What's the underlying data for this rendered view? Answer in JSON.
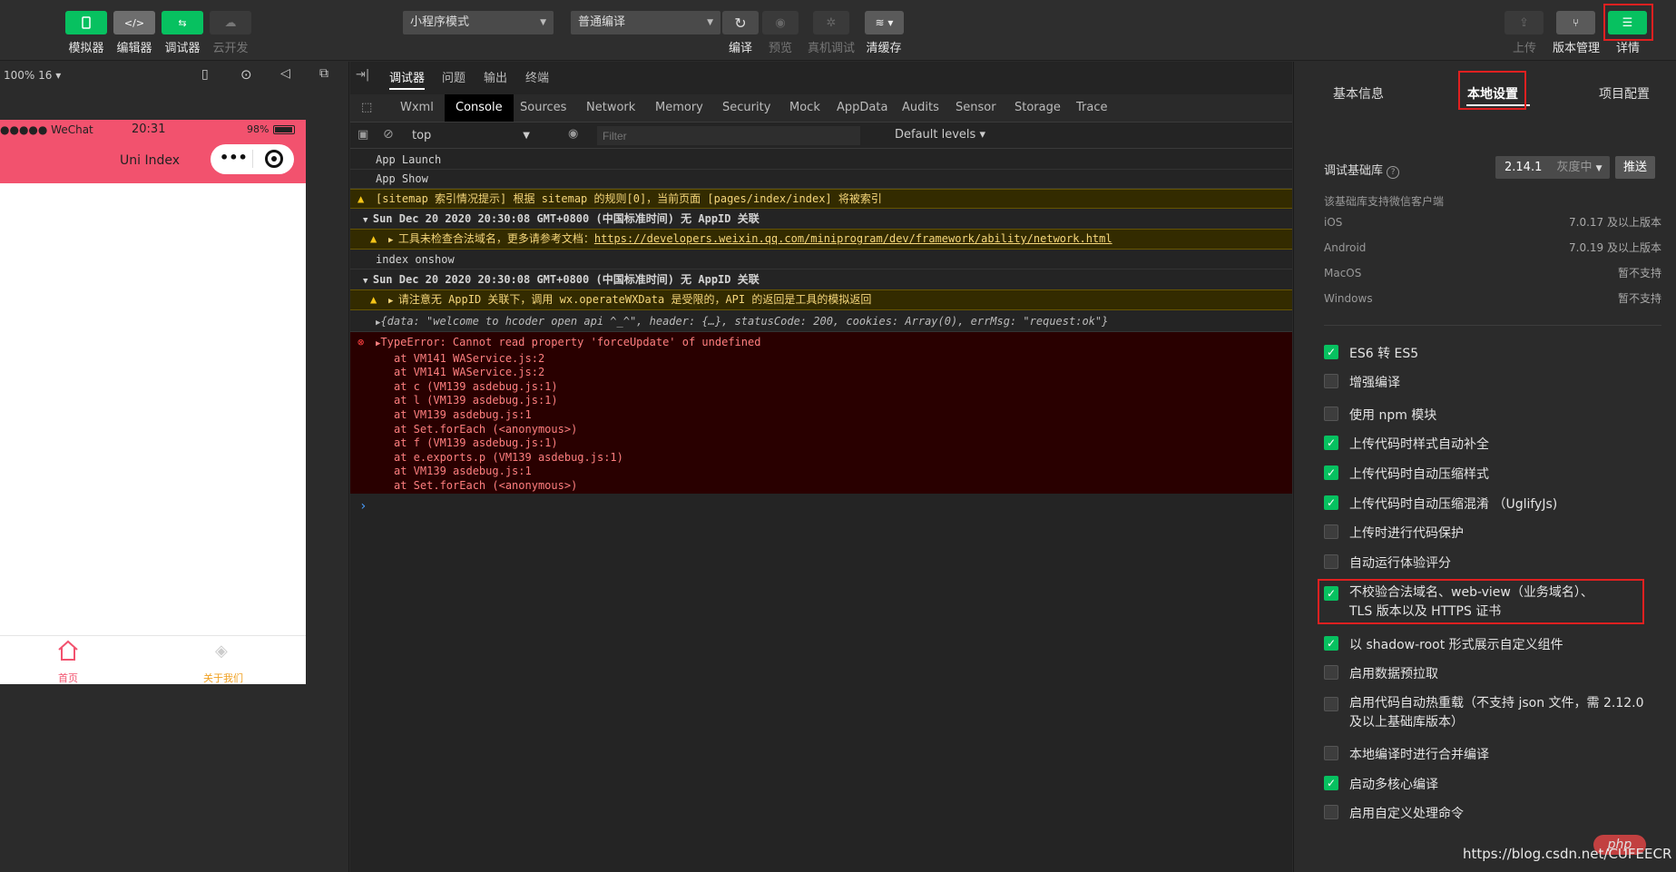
{
  "toolbar": {
    "left_buttons": [
      {
        "label": "模拟器",
        "icon": "phone-icon",
        "color": "#07c160"
      },
      {
        "label": "编辑器",
        "icon": "code-icon",
        "color": "#6e6e6e"
      },
      {
        "label": "调试器",
        "icon": "debug-icon",
        "color": "#07c160"
      },
      {
        "label": "云开发",
        "icon": "cloud-icon",
        "color": "#3a3a3a"
      }
    ],
    "mode_select": "小程序模式",
    "compile_select": "普通编译",
    "mid_buttons": [
      {
        "label": "编译",
        "icon": "refresh-icon"
      },
      {
        "label": "预览",
        "icon": "eye-icon"
      },
      {
        "label": "真机调试",
        "icon": "bug-icon"
      },
      {
        "label": "清缓存",
        "icon": "layers-icon"
      }
    ],
    "right_buttons": [
      {
        "label": "上传",
        "icon": "upload-icon"
      },
      {
        "label": "版本管理",
        "icon": "branch-icon"
      },
      {
        "label": "详情",
        "icon": "menu-icon"
      }
    ]
  },
  "simulator": {
    "zoom": "100% 16",
    "status_carrier": "●●●●● WeChat",
    "status_time": "20:31",
    "status_battery": "98%",
    "page_title": "Uni Index",
    "capsule_dots": "•••",
    "tabs": [
      {
        "label": "首页",
        "color": "#f2526e"
      },
      {
        "label": "关于我们",
        "color": "#f0a020"
      }
    ]
  },
  "debugger": {
    "top_tabs": [
      "调试器",
      "问题",
      "输出",
      "终端"
    ],
    "panel_tabs": [
      "Wxml",
      "Console",
      "Sources",
      "Network",
      "Memory",
      "Security",
      "Mock",
      "AppData",
      "Audits",
      "Sensor",
      "Storage",
      "Trace"
    ],
    "active_panel": "Console",
    "context": "top",
    "filter_placeholder": "Filter",
    "levels": "Default levels",
    "logs": {
      "l1": "App Launch",
      "l2": "App Show",
      "l3": "[sitemap 索引情况提示] 根据 sitemap 的规则[0]，当前页面 [pages/index/index] 将被索引",
      "l4": "Sun Dec 20 2020 20:30:08 GMT+0800 (中国标准时间) 无 AppID 关联",
      "l5_text": "工具未检查合法域名，更多请参考文档：",
      "l5_link": "https://developers.weixin.qq.com/miniprogram/dev/framework/ability/network.html",
      "l6": "index onshow",
      "l7": "Sun Dec 20 2020 20:30:08 GMT+0800 (中国标准时间) 无 AppID 关联",
      "l8": "请注意无 AppID 关联下，调用 wx.operateWXData 是受限的，API 的返回是工具的模拟返回",
      "l9": "{data: \"welcome to hcoder open api ^_^\", header: {…}, statusCode: 200, cookies: Array(0), errMsg: \"request:ok\"}",
      "err_title": "TypeError: Cannot read property 'forceUpdate' of undefined",
      "stack": [
        "at VM141 WAService.js:2",
        "at VM141 WAService.js:2",
        "at c (VM139 asdebug.js:1)",
        "at l (VM139 asdebug.js:1)",
        "at VM139 asdebug.js:1",
        "at Set.forEach (<anonymous>)",
        "at f (VM139 asdebug.js:1)",
        "at e.exports.p (VM139 asdebug.js:1)",
        "at VM139 asdebug.js:1",
        "at Set.forEach (<anonymous>)"
      ],
      "prompt": "›"
    }
  },
  "settings": {
    "tabs": [
      "基本信息",
      "本地设置",
      "项目配置"
    ],
    "active_tab": "本地设置",
    "lib_label": "调试基础库",
    "lib_version": "2.14.1",
    "lib_channel": "灰度中",
    "push_label": "推送",
    "support_title": "该基础库支持微信客户端",
    "support": [
      {
        "os": "iOS",
        "ver": "7.0.17 及以上版本"
      },
      {
        "os": "Android",
        "ver": "7.0.19 及以上版本"
      },
      {
        "os": "MacOS",
        "ver": "暂不支持"
      },
      {
        "os": "Windows",
        "ver": "暂不支持"
      }
    ],
    "options": [
      {
        "label": "ES6 转 ES5",
        "checked": true
      },
      {
        "label": "增强编译",
        "checked": false
      },
      {
        "label": "使用 npm 模块",
        "checked": false
      },
      {
        "label": "上传代码时样式自动补全",
        "checked": true
      },
      {
        "label": "上传代码时自动压缩样式",
        "checked": true
      },
      {
        "label": "上传代码时自动压缩混淆 （UglifyJs)",
        "checked": true
      },
      {
        "label": "上传时进行代码保护",
        "checked": false
      },
      {
        "label": "自动运行体验评分",
        "checked": false
      },
      {
        "label": "不校验合法域名、web-view（业务域名）、TLS 版本以及 HTTPS 证书",
        "checked": true
      },
      {
        "label": "以 shadow-root 形式展示自定义组件",
        "checked": true
      },
      {
        "label": "启用数据预拉取",
        "checked": false
      },
      {
        "label": "启用代码自动热重载（不支持 json 文件，需 2.12.0 及以上基础库版本）",
        "checked": false
      },
      {
        "label": "本地编译时进行合并编译",
        "checked": false
      },
      {
        "label": "启动多核心编译",
        "checked": true
      },
      {
        "label": "启用自定义处理命令",
        "checked": false
      }
    ]
  },
  "watermark": {
    "php": "php",
    "url": "https://blog.csdn.net/CUFEECR"
  },
  "colors": {
    "green": "#07c160",
    "pink": "#f2526e",
    "highlight": "#e02020"
  }
}
